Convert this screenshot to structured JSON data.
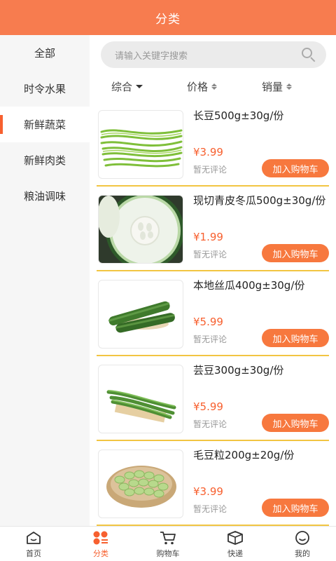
{
  "header": {
    "title": "分类"
  },
  "colors": {
    "accent": "#f77c4f",
    "price": "#f7602f",
    "divider": "#f2c542"
  },
  "sidebar": {
    "items": [
      {
        "label": "全部",
        "active": false
      },
      {
        "label": "时令水果",
        "active": false
      },
      {
        "label": "新鲜蔬菜",
        "active": true
      },
      {
        "label": "新鲜肉类",
        "active": false
      },
      {
        "label": "粮油调味",
        "active": false
      }
    ]
  },
  "search": {
    "placeholder": "请输入关键字搜索",
    "icon": "search-icon"
  },
  "sort": [
    {
      "label": "综合",
      "mode": "dropdown"
    },
    {
      "label": "价格",
      "mode": "updown"
    },
    {
      "label": "销量",
      "mode": "updown"
    }
  ],
  "products": [
    {
      "name": "长豆500g±30g/份",
      "price": "¥3.99",
      "review": "暂无评论",
      "button": "加入购物车",
      "image": "long-beans"
    },
    {
      "name": "现切青皮冬瓜500g±30g/份",
      "price": "¥1.99",
      "review": "暂无评论",
      "button": "加入购物车",
      "image": "winter-melon"
    },
    {
      "name": "本地丝瓜400g±30g/份",
      "price": "¥5.99",
      "review": "暂无评论",
      "button": "加入购物车",
      "image": "luffa"
    },
    {
      "name": "芸豆300g±30g/份",
      "price": "¥5.99",
      "review": "暂无评论",
      "button": "加入购物车",
      "image": "kidney-beans"
    },
    {
      "name": "毛豆粒200g±20g/份",
      "price": "¥3.99",
      "review": "暂无评论",
      "button": "加入购物车",
      "image": "edamame"
    }
  ],
  "tabbar": {
    "items": [
      {
        "label": "首页",
        "icon": "home-icon",
        "active": false
      },
      {
        "label": "分类",
        "icon": "category-icon",
        "active": true
      },
      {
        "label": "购物车",
        "icon": "cart-icon",
        "active": false
      },
      {
        "label": "快递",
        "icon": "package-icon",
        "active": false
      },
      {
        "label": "我的",
        "icon": "profile-icon",
        "active": false
      }
    ]
  }
}
